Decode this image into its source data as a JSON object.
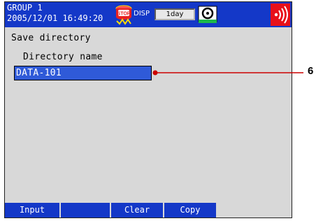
{
  "status_bar": {
    "group": "GROUP 1",
    "datetime": "2005/12/01 16:49:20",
    "disp_label": "DISP",
    "time_div": "1day",
    "icons": [
      "stop-icon",
      "media-icon",
      "alarm-icon"
    ]
  },
  "page": {
    "title": "Save directory",
    "field_label": "Directory name",
    "field_value": "DATA-101"
  },
  "softkeys": [
    "Input",
    "",
    "Clear",
    "Copy"
  ],
  "callout": {
    "number": "6"
  },
  "colors": {
    "status_bar": "#1438c8",
    "screen_bg": "#d8d8d8",
    "input_bg": "#2f5ad8",
    "callout": "#cc0000",
    "alarm": "#e8101a"
  }
}
